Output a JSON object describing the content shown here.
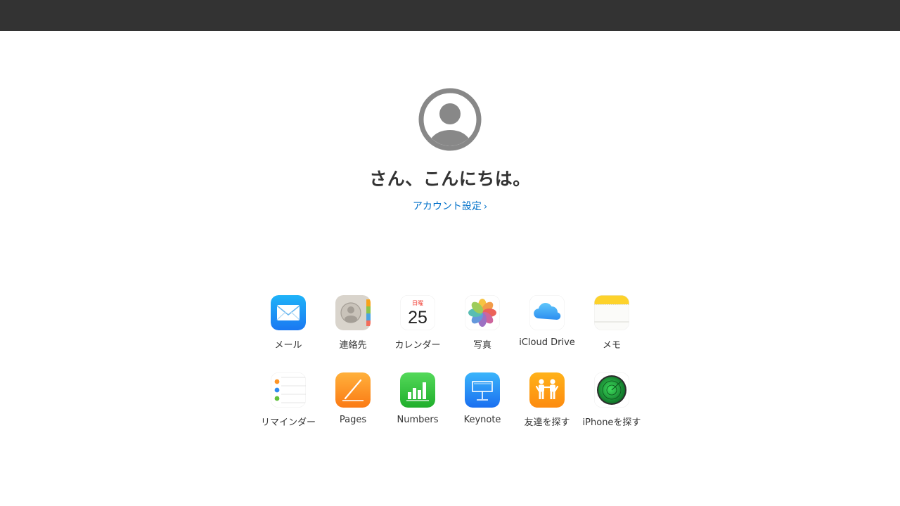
{
  "greeting": "さん、こんにちは。",
  "account": {
    "label": "アカウント設定",
    "chevron": "›"
  },
  "calendar": {
    "weekday": "日曜",
    "day": "25"
  },
  "apps": [
    {
      "label": "メール",
      "icon": "mail-icon"
    },
    {
      "label": "連絡先",
      "icon": "contacts-icon"
    },
    {
      "label": "カレンダー",
      "icon": "calendar-icon"
    },
    {
      "label": "写真",
      "icon": "photos-icon"
    },
    {
      "label": "iCloud Drive",
      "icon": "icloud-drive-icon"
    },
    {
      "label": "メモ",
      "icon": "notes-icon"
    },
    {
      "label": "リマインダー",
      "icon": "reminders-icon"
    },
    {
      "label": "Pages",
      "icon": "pages-icon"
    },
    {
      "label": "Numbers",
      "icon": "numbers-icon"
    },
    {
      "label": "Keynote",
      "icon": "keynote-icon"
    },
    {
      "label": "友達を探す",
      "icon": "find-friends-icon"
    },
    {
      "label": "iPhoneを探す",
      "icon": "find-iphone-icon"
    }
  ],
  "colors": {
    "topbar": "#333333",
    "link": "#0070c9",
    "avatar": "#888888",
    "text": "#333333"
  }
}
